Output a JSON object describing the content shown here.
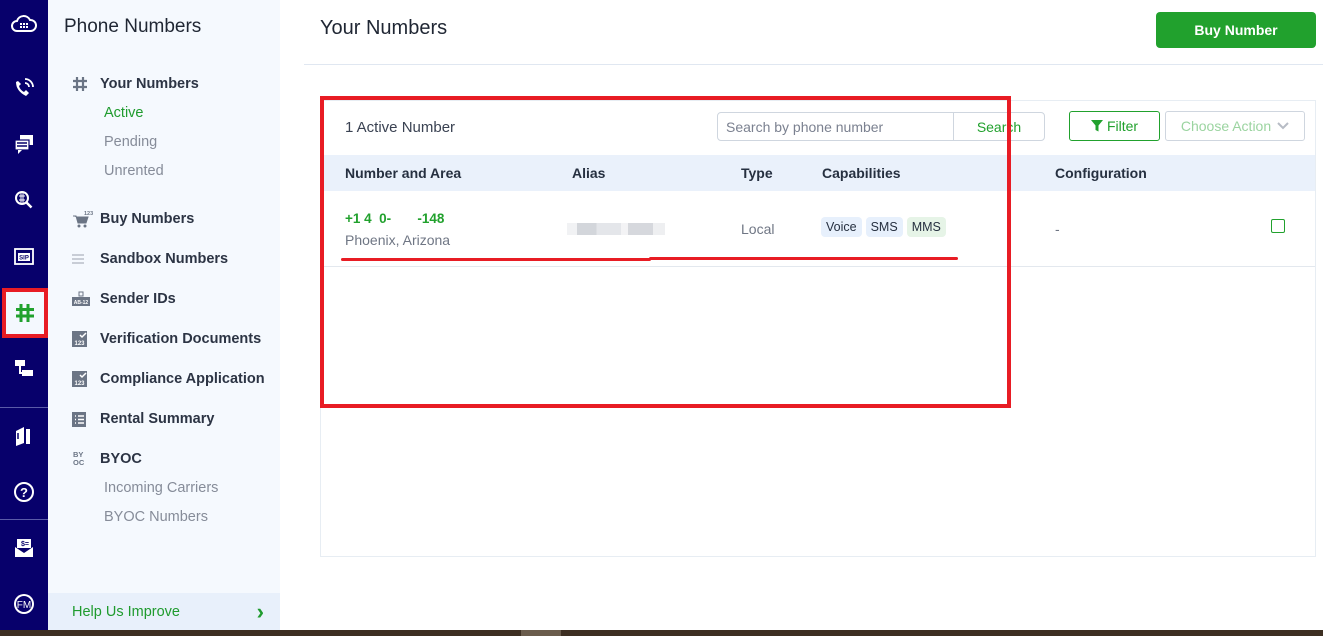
{
  "rail": {
    "items": [
      {
        "icon": "cloud-grid-icon"
      },
      {
        "icon": "phone-signal-icon"
      },
      {
        "icon": "messages-icon"
      },
      {
        "icon": "global-search-icon"
      },
      {
        "icon": "sip-icon"
      },
      {
        "icon": "hash-icon",
        "active": true
      },
      {
        "icon": "flow-icon"
      },
      {
        "icon": "docs-icon"
      },
      {
        "icon": "help-icon"
      },
      {
        "icon": "billing-mail-icon"
      },
      {
        "icon": "fm-icon"
      }
    ]
  },
  "subnav": {
    "title": "Phone Numbers",
    "your_numbers": "Your Numbers",
    "active": "Active",
    "pending": "Pending",
    "unrented": "Unrented",
    "buy_numbers": "Buy Numbers",
    "buy_badge": "123",
    "sandbox_numbers": "Sandbox Numbers",
    "sender_ids": "Sender IDs",
    "sender_badge": "AB-12",
    "verification_documents": "Verification Documents",
    "compliance_application": "Compliance Application",
    "doc_badge": "123",
    "rental_summary": "Rental Summary",
    "byoc": "BYOC",
    "byoc_badge_top": "BY",
    "byoc_badge_bottom": "OC",
    "incoming_carriers": "Incoming Carriers",
    "byoc_numbers": "BYOC Numbers",
    "help": "Help Us Improve",
    "help_chevron": "›"
  },
  "main": {
    "title": "Your Numbers",
    "buy_button": "Buy Number",
    "count_label": "1 Active Number",
    "search_placeholder": "Search by phone number",
    "search_button": "Search",
    "filter_button": "Filter",
    "action_button": "Choose Action",
    "columns": [
      "Number and Area",
      "Alias",
      "Type",
      "Capabilities",
      "Configuration"
    ],
    "rows": [
      {
        "number": "+1 4  0-       -148",
        "area": "Phoenix, Arizona",
        "alias": "",
        "type": "Local",
        "capabilities": [
          "Voice",
          "SMS",
          "MMS"
        ],
        "configuration": "-",
        "selected": false
      }
    ]
  },
  "colors": {
    "rail": "#07006b",
    "accent": "#21a12d",
    "annotation": "#e81c24"
  }
}
